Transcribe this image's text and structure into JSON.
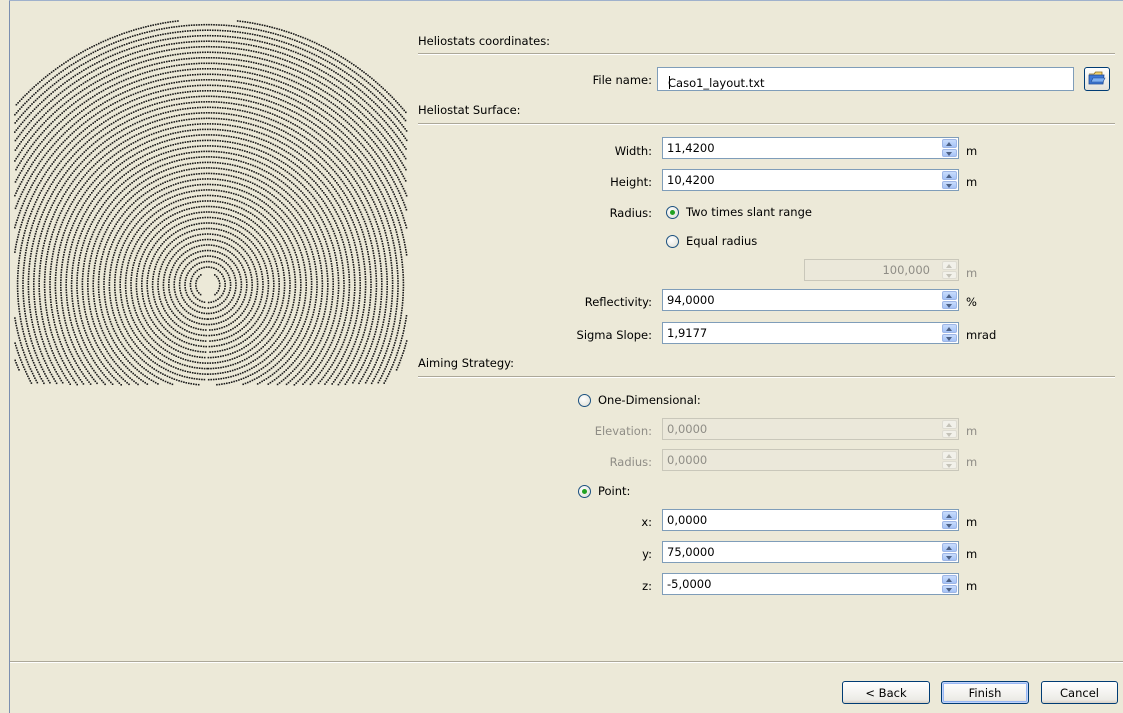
{
  "sections": {
    "coordinates": "Heliostats coordinates:",
    "surface": "Heliostat Surface:",
    "aiming": "Aiming Strategy:"
  },
  "file": {
    "label": "File name:",
    "value": "Caso1_layout.txt"
  },
  "surface": {
    "width": {
      "label": "Width:",
      "value": "11,4200",
      "unit": "m"
    },
    "height": {
      "label": "Height:",
      "value": "10,4200",
      "unit": "m"
    },
    "radius": {
      "label": "Radius:",
      "option1": "Two times slant range",
      "option2": "Equal radius",
      "equal_value": "100,000",
      "unit": "m",
      "selected": "option1"
    },
    "reflectivity": {
      "label": "Reflectivity:",
      "value": "94,0000",
      "unit": "%"
    },
    "sigma_slope": {
      "label": "Sigma Slope:",
      "value": "1,9177",
      "unit": "mrad"
    }
  },
  "aiming": {
    "one_dimensional": "One-Dimensional:",
    "elevation": {
      "label": "Elevation:",
      "value": "0,0000",
      "unit": "m"
    },
    "radius": {
      "label": "Radius:",
      "value": "0,0000",
      "unit": "m"
    },
    "point": "Point:",
    "selected": "point",
    "x": {
      "label": "x:",
      "value": "0,0000",
      "unit": "m"
    },
    "y": {
      "label": "y:",
      "value": "75,0000",
      "unit": "m"
    },
    "z": {
      "label": "z:",
      "value": "-5,0000",
      "unit": "m"
    }
  },
  "buttons": {
    "back": "< Back",
    "finish": "Finish",
    "cancel": "Cancel"
  },
  "icons": {
    "browse": "open-folder-icon",
    "spinner": "spinner-arrows-icon"
  },
  "colors": {
    "background": "#ece9d8",
    "heliostat_dot": "#1a1a1a",
    "radio_selected": "#21a121"
  }
}
